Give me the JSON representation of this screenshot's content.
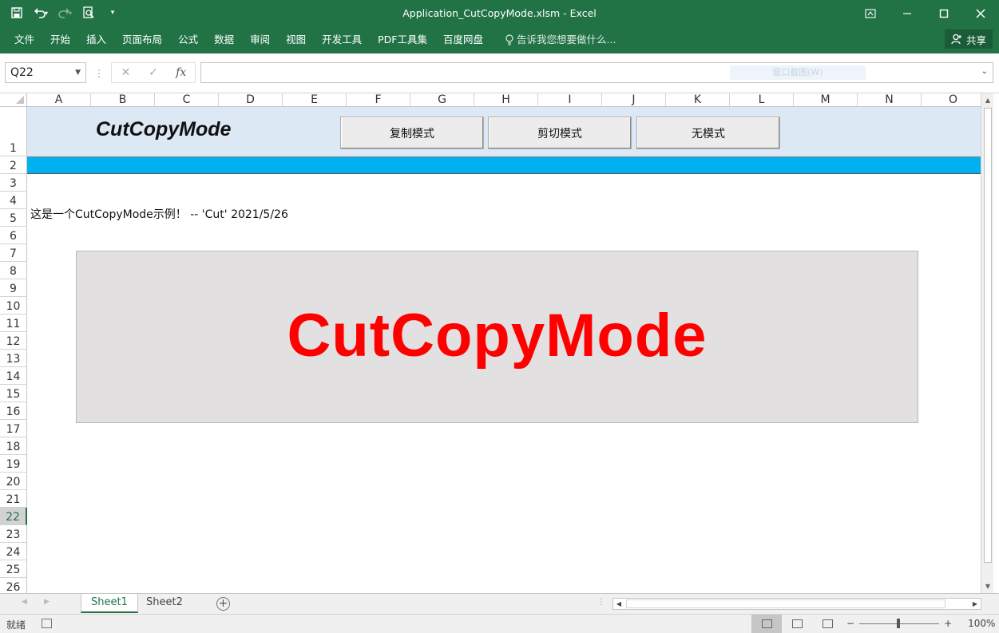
{
  "window": {
    "title": "Application_CutCopyMode.xlsm - Excel",
    "controls": [
      "ribbon-display-icon",
      "minimize-icon",
      "maximize-icon",
      "close-icon"
    ]
  },
  "ribbon": {
    "tabs": [
      "文件",
      "开始",
      "插入",
      "页面布局",
      "公式",
      "数据",
      "审阅",
      "视图",
      "开发工具",
      "PDF工具集",
      "百度网盘"
    ],
    "tell_me": "告诉我您想要做什么...",
    "share": "共享"
  },
  "formula_bar": {
    "name_box": "Q22",
    "fx": "fx",
    "formula": "",
    "ghost_overlay": "窗口截图(W)"
  },
  "grid": {
    "columns": [
      "A",
      "B",
      "C",
      "D",
      "E",
      "F",
      "G",
      "H",
      "I",
      "J",
      "K",
      "L",
      "M",
      "N",
      "O"
    ],
    "rows": [
      "1",
      "2",
      "3",
      "4",
      "5",
      "6",
      "7",
      "8",
      "9",
      "10",
      "11",
      "12",
      "13",
      "14",
      "15",
      "16",
      "17",
      "18",
      "19",
      "20",
      "21",
      "22",
      "23",
      "24",
      "25",
      "26"
    ],
    "selected_row": "22"
  },
  "sheet": {
    "header_title": "CutCopyMode",
    "buttons": [
      "复制模式",
      "剪切模式",
      "无模式"
    ],
    "note": "这是一个CutCopyMode示例！ -- 'Cut' 2021/5/26",
    "banner_text": "CutCopyMode"
  },
  "sheet_tabs": [
    "Sheet1",
    "Sheet2"
  ],
  "active_sheet": "Sheet1",
  "status_bar": {
    "ready": "就绪",
    "zoom": "100%"
  },
  "colors": {
    "accent": "#217346",
    "header_band": "#dce9f5",
    "divider_band": "#00b0f0",
    "banner_bg": "#e2e0e0",
    "banner_text": "#ff0000"
  }
}
